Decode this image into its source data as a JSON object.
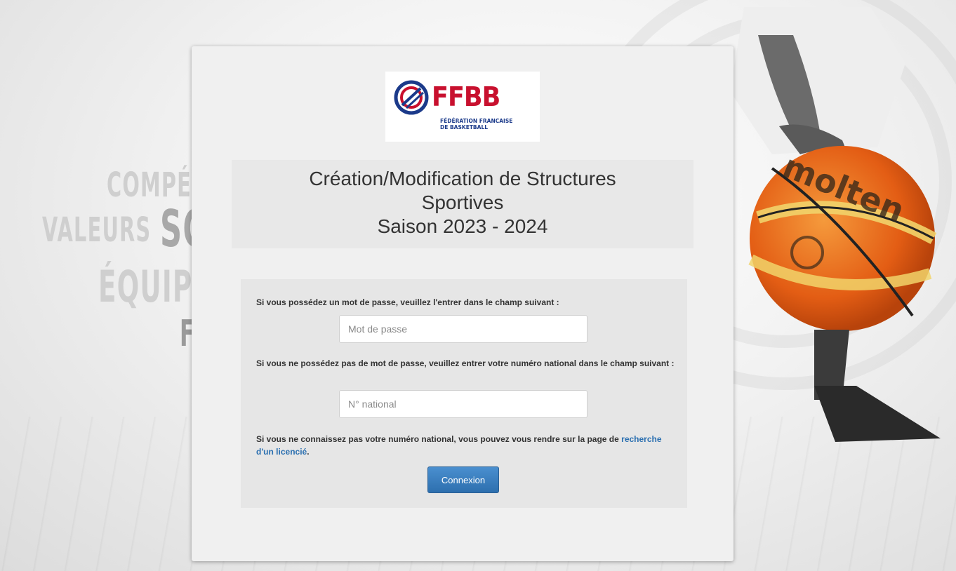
{
  "background": {
    "words": [
      "COMPÉT",
      "VALEURS",
      "SO",
      "ÉQUIP",
      "F"
    ]
  },
  "logo": {
    "name": "FFBB",
    "subtitle_line1": "FÉDÉRATION FRANCAISE",
    "subtitle_line2": "DE BASKETBALL"
  },
  "title": {
    "line1": "Création/Modification de Structures",
    "line2": "Sportives",
    "line3": "Saison 2023 - 2024"
  },
  "form": {
    "password_prompt": "Si vous possédez un mot de passe, veuillez l'entrer dans le champ suivant :",
    "password_placeholder": "Mot de passe",
    "national_prompt": "Si vous ne possédez pas de mot de passe, veuillez entrer votre numéro national dans le champ suivant :",
    "national_placeholder": "N° national",
    "help_text": "Si vous ne connaissez pas votre numéro national, vous pouvez vous rendre sur la page de ",
    "help_link": "recherche d'un licencié",
    "help_end": ".",
    "submit_label": "Connexion"
  },
  "colors": {
    "brand_red": "#c8102e",
    "brand_blue": "#1b3a8a",
    "button_blue": "#2d6fae",
    "link_blue": "#2a6fb0",
    "ball_orange": "#e8641b"
  }
}
